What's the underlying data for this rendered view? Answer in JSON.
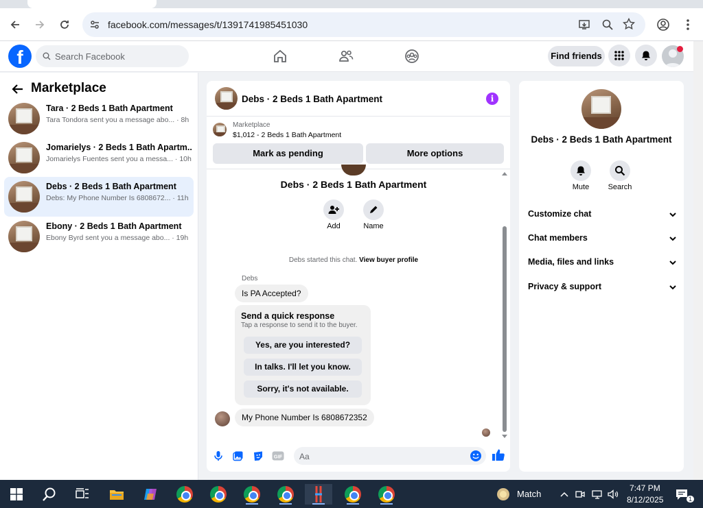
{
  "browser": {
    "url": "facebook.com/messages/t/1391741985451030"
  },
  "fb_header": {
    "search_placeholder": "Search Facebook",
    "find_friends_label": "Find friends"
  },
  "left": {
    "title": "Marketplace",
    "conversations": [
      {
        "name": "Tara · 2 Beds 1 Bath Apartment",
        "snippet": "Tara Tondora sent you a message abo... · 8h"
      },
      {
        "name": "Jomarielys · 2 Beds 1 Bath Apartm...",
        "snippet": "Jomarielys Fuentes sent you a messa... · 10h"
      },
      {
        "name": "Debs · 2 Beds 1 Bath Apartment",
        "snippet": "Debs: My Phone Number Is 6808672... · 11h"
      },
      {
        "name": "Ebony · 2 Beds 1 Bath Apartment",
        "snippet": "Ebony Byrd sent you a message abo... · 19h"
      }
    ]
  },
  "chat": {
    "title": "Debs · 2 Beds 1 Bath Apartment",
    "marketplace_label": "Marketplace",
    "listing": "$1,012 - 2 Beds 1 Bath Apartment",
    "mark_pending_label": "Mark as pending",
    "more_options_label": "More options",
    "profile_name": "Debs · 2 Beds 1 Bath Apartment",
    "add_label": "Add",
    "name_label": "Name",
    "system_text": "Debs started this chat.",
    "view_buyer_label": "View buyer profile",
    "sender": "Debs",
    "message_1": "Is PA Accepted?",
    "quick_title": "Send a quick response",
    "quick_sub": "Tap a response to send it to the buyer.",
    "quick_responses": [
      "Yes, are you interested?",
      "In talks. I'll let you know.",
      "Sorry, it's not available."
    ],
    "message_2": "My Phone Number Is 6808672352",
    "composer_placeholder": "Aa"
  },
  "right": {
    "name": "Debs · 2 Beds 1 Bath Apartment",
    "mute_label": "Mute",
    "search_label": "Search",
    "sections": [
      "Customize chat",
      "Chat members",
      "Media, files and links",
      "Privacy & support"
    ]
  },
  "taskbar": {
    "weather_label": "Match",
    "time": "7:47 PM",
    "date": "8/12/2025",
    "notification_count": "1"
  },
  "colors": {
    "fb_blue": "#0866ff",
    "active_conv": "#e7f0fd",
    "info_purple": "#a033ff"
  }
}
